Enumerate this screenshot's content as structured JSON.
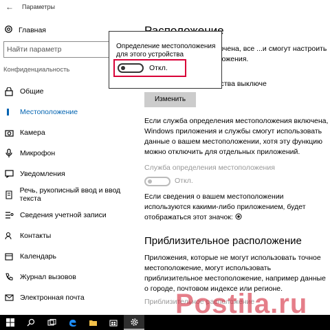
{
  "window": {
    "title": "Параметры"
  },
  "sidebar": {
    "home_label": "Главная",
    "search_placeholder": "Найти параметр",
    "section_label": "Конфиденциальность",
    "items": [
      {
        "label": "Общие",
        "icon": "lock-icon"
      },
      {
        "label": "Местоположение",
        "icon": "location-icon",
        "active": true
      },
      {
        "label": "Камера",
        "icon": "camera-icon"
      },
      {
        "label": "Микрофон",
        "icon": "microphone-icon"
      },
      {
        "label": "Уведомления",
        "icon": "notifications-icon"
      },
      {
        "label": "Речь, рукописный ввод и ввод текста",
        "icon": "speech-icon"
      },
      {
        "label": "Сведения учетной записи",
        "icon": "account-icon"
      },
      {
        "label": "Контакты",
        "icon": "contacts-icon"
      },
      {
        "label": "Календарь",
        "icon": "calendar-icon"
      },
      {
        "label": "Журнал вызовов",
        "icon": "call-history-icon"
      },
      {
        "label": "Электронная почта",
        "icon": "email-icon"
      }
    ]
  },
  "main": {
    "heading": "Расположение",
    "para1": "...и расположения включена, все ...и смогут настроить собственные ... расположения.",
    "para2": "...ния для этого устройства выключе",
    "change_button": "Изменить",
    "para3": "Если служба определения местоположения включена, Windows приложения и службы смогут использовать данные о вашем местоположении, хотя эту функцию можно отключить для отдельных приложений.",
    "service_label": "Служба определения местоположения",
    "service_state": "Откл.",
    "para4": "Если сведения о вашем местоположении используются какими-либо приложением, будет отображаться этот значок:",
    "heading2": "Приблизительное расположение",
    "para5": "Приложения, которые не могут использовать точное местоположение, могут использовать приблизительное местоположение, например данные о городе, почтовом индексе или регионе.",
    "faded_label": "Приблизительное расположение"
  },
  "popup": {
    "title": "Определение местоположения для этого устройства",
    "state": "Откл.",
    "highlight_color": "#d80036"
  },
  "watermark": {
    "text": "Postila.ru",
    "color": "#d01428"
  },
  "taskbar": {
    "items": [
      {
        "icon": "windows-start-icon"
      },
      {
        "icon": "search-icon"
      },
      {
        "icon": "task-view-icon"
      },
      {
        "icon": "edge-icon"
      },
      {
        "icon": "file-explorer-icon"
      },
      {
        "icon": "store-icon"
      },
      {
        "icon": "settings-icon",
        "active": true
      }
    ]
  }
}
